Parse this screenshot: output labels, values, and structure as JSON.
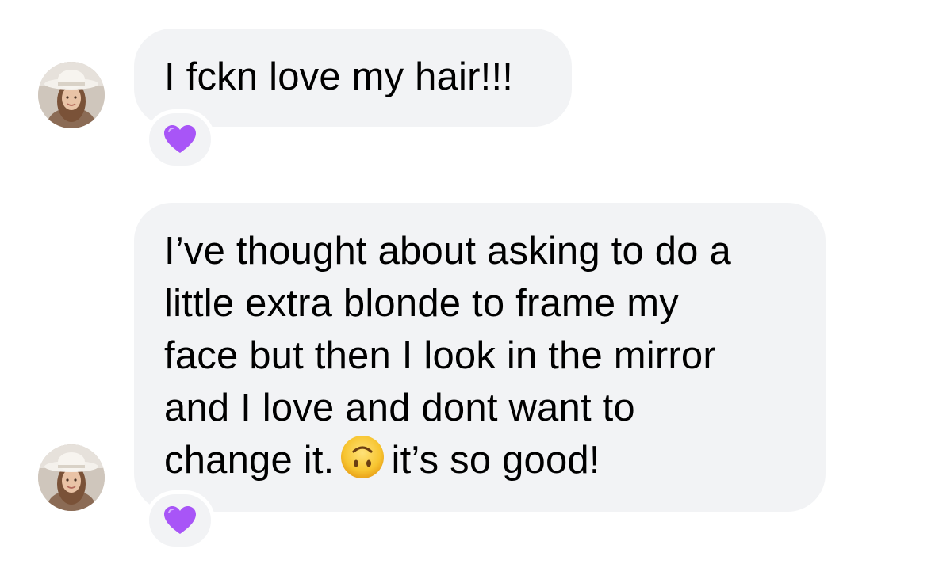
{
  "conversation": {
    "messages": [
      {
        "avatar_icon": "profile-photo-woman-white-hat",
        "text": "I fckn love my hair!!!",
        "reaction_icon": "purple-heart-icon"
      },
      {
        "avatar_icon": "profile-photo-woman-white-hat",
        "lines": [
          "I’ve thought about asking to do a",
          "little extra blonde to frame my",
          "face but then I look in the mirror",
          "and I love and dont want to",
          "change it."
        ],
        "line_after_emoji": "it’s so good!",
        "inline_emoji": "upside-down-face-icon",
        "reaction_icon": "purple-heart-icon"
      }
    ]
  },
  "colors": {
    "bubble_background": "#f2f3f5",
    "text": "#000000",
    "reaction_heart": "#a855f7",
    "emoji_face": "#f7c531"
  }
}
